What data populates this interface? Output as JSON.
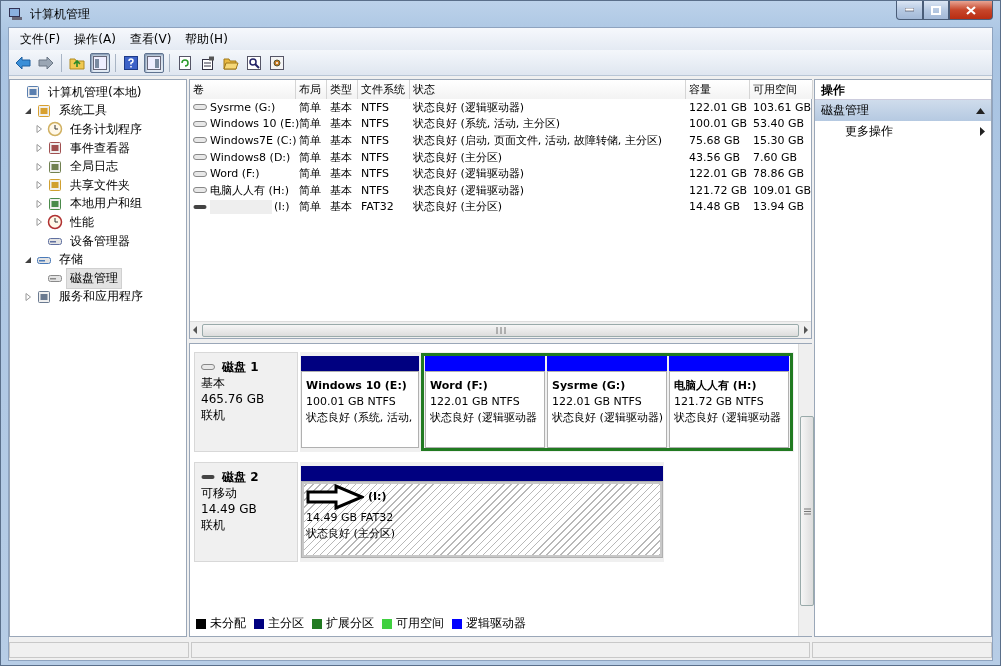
{
  "window": {
    "title": "计算机管理"
  },
  "menu": [
    "文件(F)",
    "操作(A)",
    "查看(V)",
    "帮助(H)"
  ],
  "toolbar": [
    {
      "kind": "back",
      "on": false
    },
    {
      "kind": "forward",
      "on": false
    },
    {
      "kind": "sep"
    },
    {
      "kind": "up",
      "on": false
    },
    {
      "kind": "tree",
      "on": true
    },
    {
      "kind": "sep"
    },
    {
      "kind": "help",
      "on": false
    },
    {
      "kind": "pane",
      "on": true
    },
    {
      "kind": "sep"
    },
    {
      "kind": "refresh",
      "on": false
    },
    {
      "kind": "properties",
      "on": false
    },
    {
      "kind": "open",
      "on": false
    },
    {
      "kind": "find",
      "on": false
    },
    {
      "kind": "settings",
      "on": false
    }
  ],
  "tree": [
    {
      "label": "计算机管理(本地)",
      "selected": false,
      "children": [
        {
          "label": "系统工具",
          "expanded": true,
          "selected": false,
          "children": [
            {
              "label": "任务计划程序",
              "expanded": false,
              "selected": false
            },
            {
              "label": "事件查看器",
              "expanded": false,
              "selected": false
            },
            {
              "label": "全局日志",
              "expanded": false,
              "selected": false
            },
            {
              "label": "共享文件夹",
              "expanded": false,
              "selected": false
            },
            {
              "label": "本地用户和组",
              "expanded": false,
              "selected": false
            },
            {
              "label": "性能",
              "expanded": false,
              "selected": false
            },
            {
              "label": "设备管理器",
              "selected": false
            }
          ]
        },
        {
          "label": "存储",
          "expanded": true,
          "selected": false,
          "children": [
            {
              "label": "磁盘管理",
              "selected": true
            }
          ]
        },
        {
          "label": "服务和应用程序",
          "expanded": false,
          "selected": false
        }
      ]
    }
  ],
  "table": {
    "columns": [
      "卷",
      "布局",
      "类型",
      "文件系统",
      "状态",
      "容量",
      "可用空间"
    ],
    "rows": [
      {
        "kind": "basic",
        "cells": [
          "Sysrme (G:)",
          "简单",
          "基本",
          "NTFS",
          "状态良好 (逻辑驱动器)",
          "122.01 GB",
          "103.61 GB"
        ]
      },
      {
        "kind": "basic",
        "cells": [
          "Windows 10 (E:)",
          "简单",
          "基本",
          "NTFS",
          "状态良好 (系统, 活动, 主分区)",
          "100.01 GB",
          "53.40 GB"
        ]
      },
      {
        "kind": "basic",
        "cells": [
          "Windows7E (C:)",
          "简单",
          "基本",
          "NTFS",
          "状态良好 (启动, 页面文件, 活动, 故障转储, 主分区)",
          "75.68 GB",
          "15.30 GB"
        ]
      },
      {
        "kind": "basic",
        "cells": [
          "Windows8 (D:)",
          "简单",
          "基本",
          "NTFS",
          "状态良好 (主分区)",
          "43.56 GB",
          "7.60 GB"
        ]
      },
      {
        "kind": "basic",
        "cells": [
          "Word (F:)",
          "简单",
          "基本",
          "NTFS",
          "状态良好 (逻辑驱动器)",
          "122.01 GB",
          "78.86 GB"
        ]
      },
      {
        "kind": "basic",
        "cells": [
          "电脑人人有 (H:)",
          "简单",
          "基本",
          "NTFS",
          "状态良好 (逻辑驱动器)",
          "121.72 GB",
          "109.01 GB"
        ]
      },
      {
        "kind": "removable",
        "cells": [
          "(I:)",
          "简单",
          "基本",
          "FAT32",
          "状态良好 (主分区)",
          "14.48 GB",
          "13.94 GB"
        ]
      }
    ]
  },
  "disks": [
    {
      "kind": "basic",
      "name": "磁盘 1",
      "type": "基本",
      "size": "465.76 GB",
      "status": "联机",
      "partitions": [
        {
          "kind": "primary",
          "title": "Windows 10  (E:)",
          "size": "100.01 GB NTFS",
          "status": "状态良好 (系统, 活动,",
          "selected": false
        },
        {
          "kind": "extended",
          "children": [
            {
              "kind": "logical",
              "title": "Word  (F:)",
              "size": "122.01 GB NTFS",
              "status": "状态良好 (逻辑驱动器",
              "selected": false
            },
            {
              "kind": "logical",
              "title": "Sysrme  (G:)",
              "size": "122.01 GB NTFS",
              "status": "状态良好 (逻辑驱动器)",
              "selected": false
            },
            {
              "kind": "logical",
              "title": "电脑人人有  (H:)",
              "size": "121.72 GB NTFS",
              "status": "状态良好 (逻辑驱动器",
              "selected": false
            }
          ]
        }
      ]
    },
    {
      "kind": "removable",
      "name": "磁盘 2",
      "type": "可移动",
      "size": "14.49 GB",
      "status": "联机",
      "partitions": [
        {
          "kind": "primary",
          "title": "(I:)",
          "size": "14.49 GB FAT32",
          "status": "状态良好 (主分区)",
          "selected": true,
          "arrow": true
        }
      ]
    }
  ],
  "legend": [
    {
      "label": "未分配",
      "color": "#000000"
    },
    {
      "label": "主分区",
      "color": "#000080"
    },
    {
      "label": "扩展分区",
      "color": "#217a21"
    },
    {
      "label": "可用空间",
      "color": "#40d040"
    },
    {
      "label": "逻辑驱动器",
      "color": "#0000ff"
    }
  ],
  "actions": {
    "title": "操作",
    "sections": [
      {
        "label": "磁盘管理",
        "expanded": true,
        "items": [
          {
            "label": "更多操作"
          }
        ]
      }
    ]
  }
}
